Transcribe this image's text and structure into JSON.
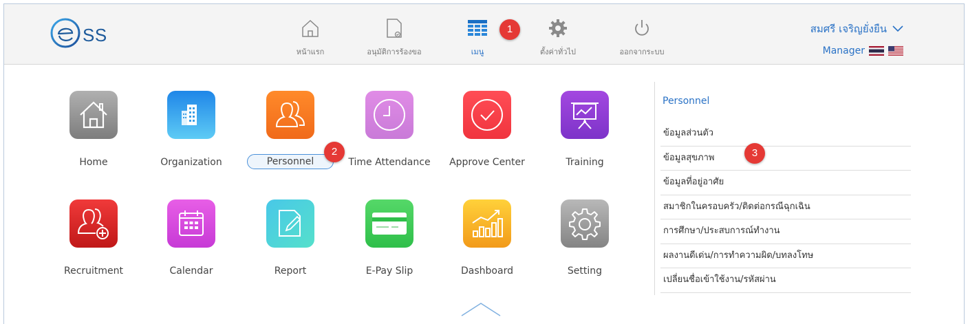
{
  "logo": {
    "icon_name": "ess-logo-icon",
    "text": "SS"
  },
  "topnav": [
    {
      "label": "หน้าแรก",
      "icon": "home-icon"
    },
    {
      "label": "อนุมัติการร้องขอ",
      "icon": "approve-document-icon"
    },
    {
      "label": "เมนู",
      "icon": "grid-menu-icon",
      "active": true
    },
    {
      "label": "ตั้งค่าทั่วไป",
      "icon": "gear-icon"
    },
    {
      "label": "ออกจากระบบ",
      "icon": "power-icon"
    }
  ],
  "badges": [
    "1",
    "2",
    "3"
  ],
  "user": {
    "name": "สมศรี เจริญยั่งยืน",
    "role": "Manager",
    "flags": [
      "thai-flag-icon",
      "us-flag-icon"
    ]
  },
  "apps": [
    {
      "label": "Home",
      "icon": "home-icon",
      "color_top": "#b0b0b0",
      "color_bottom": "#7d7d7d"
    },
    {
      "label": "Organization",
      "icon": "building-icon",
      "color_top": "#1f86e8",
      "color_bottom": "#5ecbf5"
    },
    {
      "label": "Personnel",
      "icon": "people-icon",
      "color_top": "#ff8a2a",
      "color_bottom": "#f06a1a",
      "selected": true
    },
    {
      "label": "Time Attendance",
      "icon": "clock-icon",
      "color_top": "#e08ce6",
      "color_bottom": "#c97ad8"
    },
    {
      "label": "Approve Center",
      "icon": "check-circle-icon",
      "color_top": "#ff4d55",
      "color_bottom": "#f0343e"
    },
    {
      "label": "Training",
      "icon": "presentation-icon",
      "color_top": "#a348e0",
      "color_bottom": "#7d33c9"
    },
    {
      "label": "Recruitment",
      "icon": "add-person-icon",
      "color_top": "#f03a3a",
      "color_bottom": "#c01818"
    },
    {
      "label": "Calendar",
      "icon": "calendar-icon",
      "color_top": "#e75ee6",
      "color_bottom": "#c73ad6"
    },
    {
      "label": "Report",
      "icon": "report-edit-icon",
      "color_top": "#48c8e8",
      "color_bottom": "#55e0cb"
    },
    {
      "label": "E-Pay Slip",
      "icon": "credit-card-icon",
      "color_top": "#55d868",
      "color_bottom": "#2fbf4a"
    },
    {
      "label": "Dashboard",
      "icon": "bar-chart-icon",
      "color_top": "#ffd13a",
      "color_bottom": "#f29a1a"
    },
    {
      "label": "Setting",
      "icon": "gear-icon",
      "color_top": "#b8b8b8",
      "color_bottom": "#848484"
    }
  ],
  "panel": {
    "title": "Personnel",
    "items": [
      "ข้อมูลส่วนตัว",
      "ข้อมูลสุขภาพ",
      "ข้อมูลที่อยู่อาศัย",
      "สมาชิกในครอบครัว/ติดต่อกรณีฉุกเฉิน",
      "การศึกษา/ประสบการณ์ทำงาน",
      "ผลงานดีเด่น/การทำความผิด/บทลงโทษ",
      "เปลี่ยนชื่อเข้าใช้งาน/รหัสผ่าน"
    ]
  }
}
